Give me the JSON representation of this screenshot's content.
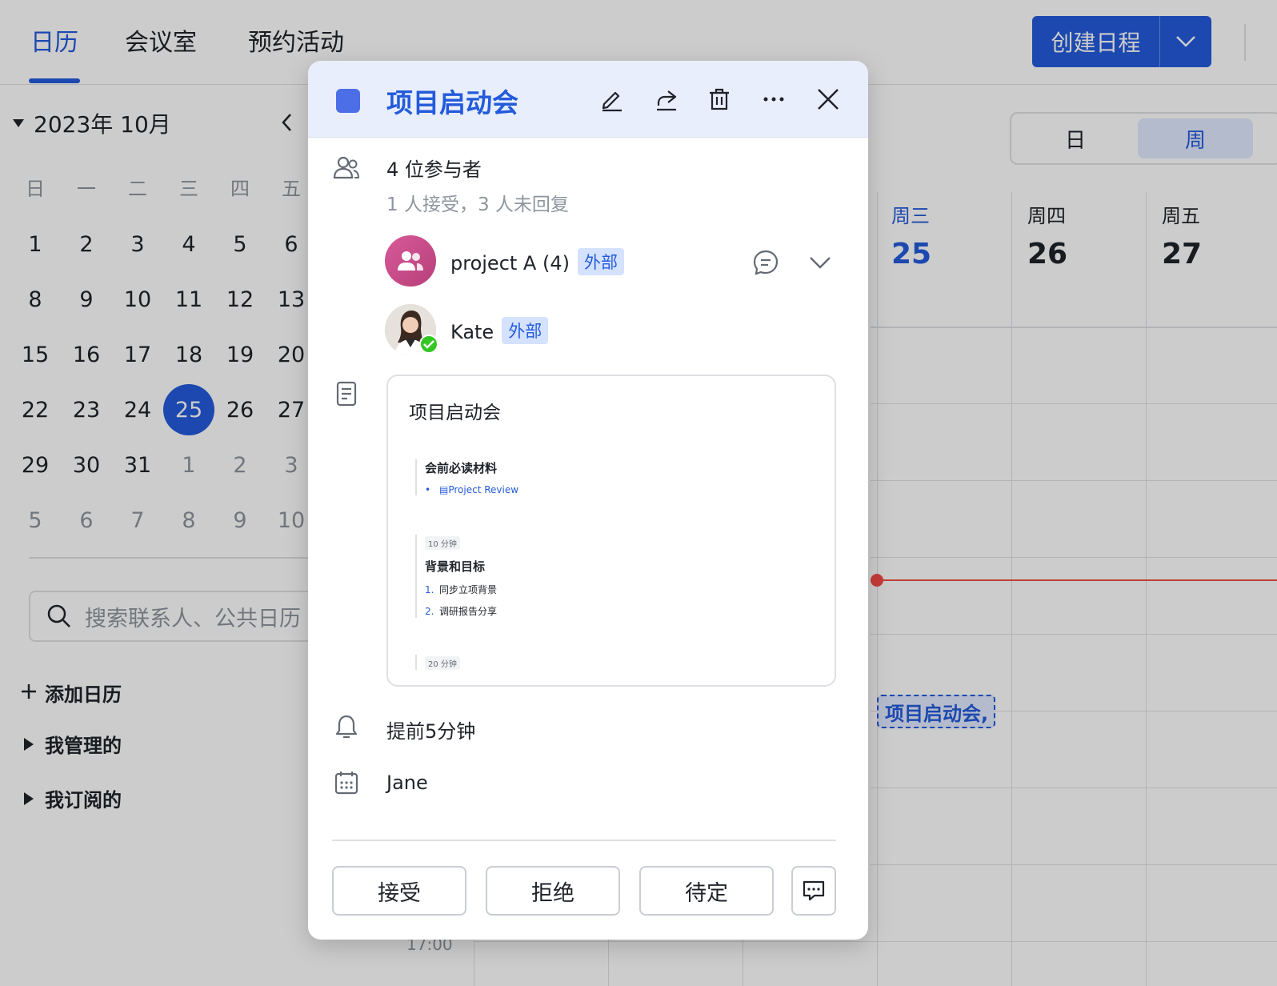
{
  "tabs": [
    {
      "label": "日历",
      "active": true
    },
    {
      "label": "会议室"
    },
    {
      "label": "预约活动"
    }
  ],
  "create_button": {
    "label": "创建日程"
  },
  "sidebar": {
    "month_title": "2023年 10月",
    "weekdays": [
      "日",
      "一",
      "二",
      "三",
      "四",
      "五"
    ],
    "weeks": [
      [
        "1",
        "2",
        "3",
        "4",
        "5",
        "6"
      ],
      [
        "8",
        "9",
        "10",
        "11",
        "12",
        "13"
      ],
      [
        "15",
        "16",
        "17",
        "18",
        "19",
        "20"
      ],
      [
        "22",
        "23",
        "24",
        "25",
        "26",
        "27"
      ],
      [
        "29",
        "30",
        "31",
        "1",
        "2",
        "3"
      ],
      [
        "5",
        "6",
        "7",
        "8",
        "9",
        "10"
      ]
    ],
    "today": "25",
    "search_placeholder": "搜索联系人、公共日历",
    "add_calendar": "添加日历",
    "managed": "我管理的",
    "subscribed": "我订阅的"
  },
  "calendar": {
    "view_day": "日",
    "view_week": "周",
    "active_view": "周",
    "columns": [
      {
        "weekday": "周三",
        "day": "25",
        "current": true
      },
      {
        "weekday": "周四",
        "day": "26"
      },
      {
        "weekday": "周五",
        "day": "27"
      }
    ],
    "event_chip": "项目启动会,",
    "time_label": "17:00"
  },
  "popup": {
    "title": "项目启动会",
    "event_color": "#4c6ee6",
    "attendees_count": "4 位参与者",
    "attendees_status": "1 人接受，3 人未回复",
    "attendees": [
      {
        "name": "project A (4)",
        "tag": "外部",
        "avatar": "group-icon"
      },
      {
        "name": "Kate",
        "tag": "外部",
        "avatar": "person-avatar",
        "accepted": true
      }
    ],
    "doc": {
      "title": "项目启动会",
      "section1_title": "会前必读材料",
      "section1_link": "Project Review",
      "section2_tag": "10 分钟",
      "section2_title": "背景和目标",
      "section2_items": [
        {
          "num": "1.",
          "text": "同步立项背景"
        },
        {
          "num": "2.",
          "text": "调研报告分享"
        }
      ],
      "section3_tag": "20 分钟"
    },
    "reminder": "提前5分钟",
    "calendar_owner": "Jane",
    "buttons": {
      "accept": "接受",
      "decline": "拒绝",
      "tentative": "待定"
    }
  },
  "colors": {
    "accent": "#245bdb",
    "now_line": "#f54a45"
  }
}
